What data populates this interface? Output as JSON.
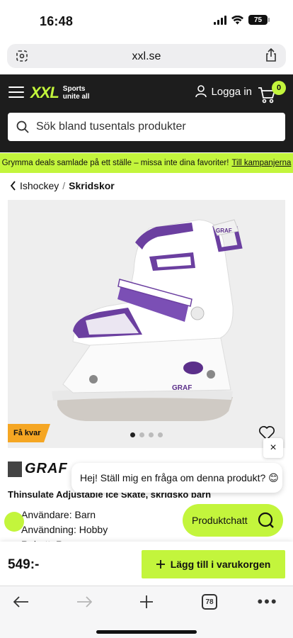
{
  "status_bar": {
    "time": "16:48",
    "battery": "75"
  },
  "browser": {
    "url": "xxl.se",
    "tab_count": "78"
  },
  "header": {
    "logo": "XXL",
    "logo_tagline_1": "Sports",
    "logo_tagline_2": "unite all",
    "login_label": "Logga in",
    "cart_count": "0",
    "search_placeholder": "Sök bland tusentals produkter"
  },
  "promo": {
    "text": "Grymma deals samlade på ett ställe – missa inte dina favoriter!",
    "link": "Till kampanjerna"
  },
  "breadcrumb": {
    "parent": "Ishockey",
    "separator": "/",
    "current": "Skridskor"
  },
  "product": {
    "badge": "Få kvar",
    "image_count": 4,
    "active_image": 1,
    "brand": "GRAF",
    "title": "Thinsulate Adjustable Ice Skate, skridsko barn",
    "specs": [
      "Användare: Barn",
      "Användning: Hobby",
      "Rabatt: Rea"
    ],
    "price": "549:-",
    "add_to_cart": "Lägg till i varukorgen"
  },
  "chat": {
    "message": "Hej! Ställ mig en fråga om denna produkt? 😊",
    "button_label": "Produktchatt",
    "close": "×"
  },
  "colors": {
    "accent": "#c3f53c",
    "header_bg": "#1d1d1d",
    "badge": "#f5a623",
    "skate_purple": "#6b3fa0"
  }
}
